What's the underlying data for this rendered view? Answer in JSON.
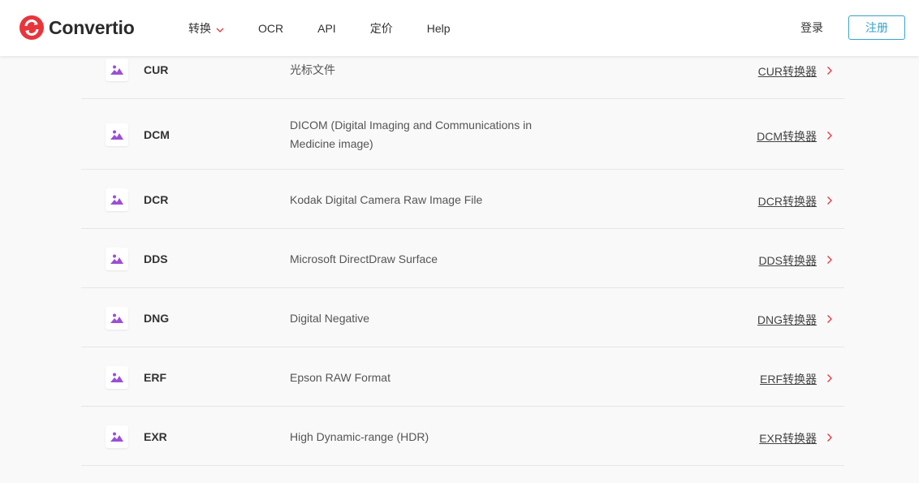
{
  "header": {
    "logo_text": "Convertio",
    "nav": [
      {
        "label": "转换",
        "has_dropdown": true
      },
      {
        "label": "OCR"
      },
      {
        "label": "API"
      },
      {
        "label": "定价"
      },
      {
        "label": "Help"
      }
    ],
    "login_label": "登录",
    "signup_label": "注册",
    "colors": {
      "brand": "#e8353b",
      "accent": "#35a3c9"
    }
  },
  "formats": [
    {
      "ext": "CUR",
      "description": "光标文件",
      "link": "CUR转换器",
      "icon": "image-icon"
    },
    {
      "ext": "DCM",
      "description": "DICOM (Digital Imaging and Communications in Medicine image)",
      "link": "DCM转换器",
      "icon": "image-icon"
    },
    {
      "ext": "DCR",
      "description": "Kodak Digital Camera Raw Image File",
      "link": "DCR转换器",
      "icon": "image-icon"
    },
    {
      "ext": "DDS",
      "description": "Microsoft DirectDraw Surface",
      "link": "DDS转换器",
      "icon": "image-icon"
    },
    {
      "ext": "DNG",
      "description": "Digital Negative",
      "link": "DNG转换器",
      "icon": "image-icon"
    },
    {
      "ext": "ERF",
      "description": "Epson RAW Format",
      "link": "ERF转换器",
      "icon": "image-icon"
    },
    {
      "ext": "EXR",
      "description": "High Dynamic-range (HDR)",
      "link": "EXR转换器",
      "icon": "image-icon"
    }
  ]
}
